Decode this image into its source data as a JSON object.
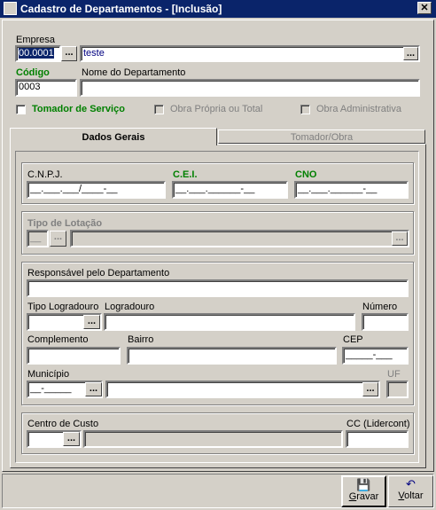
{
  "window": {
    "title": "Cadastro de Departamentos - [Inclusão]",
    "close": "✕"
  },
  "empresa": {
    "label": "Empresa",
    "code": "00.0001",
    "name": "teste",
    "lookup": "..."
  },
  "codigo": {
    "label": "Código",
    "value": "0003"
  },
  "nome_departamento": {
    "label": "Nome do Departamento",
    "value": ""
  },
  "checks": {
    "tomador": "Tomador de Serviço",
    "obra_propria": "Obra Própria ou Total",
    "obra_admin": "Obra Administrativa"
  },
  "tabs": [
    {
      "label": "Dados Gerais"
    },
    {
      "label": "Tomador/Obra"
    }
  ],
  "ids": {
    "cnpj": {
      "label": "C.N.P.J.",
      "mask": "__.___.___/____-__"
    },
    "cei": {
      "label": "C.E.I.",
      "mask": "__.___.______-__"
    },
    "cno": {
      "label": "CNO",
      "mask": "__.___.______-__"
    }
  },
  "lotacao": {
    "label": "Tipo de Lotação",
    "code": "__",
    "lookup": "...",
    "desc": "",
    "lookup2": "..."
  },
  "responsavel": {
    "label": "Responsável pelo Departamento",
    "value": ""
  },
  "tipo_logradouro": {
    "label": "Tipo Logradouro",
    "value": "",
    "lookup": "..."
  },
  "logradouro": {
    "label": "Logradouro",
    "value": ""
  },
  "numero": {
    "label": "Número",
    "value": ""
  },
  "complemento": {
    "label": "Complemento",
    "value": ""
  },
  "bairro": {
    "label": "Bairro",
    "value": ""
  },
  "cep": {
    "label": "CEP",
    "mask": "_____-___"
  },
  "municipio": {
    "label": "Município",
    "code": "__-_____",
    "lookup": "...",
    "name": "",
    "lookup2": "..."
  },
  "uf": {
    "label": "UF",
    "value": ""
  },
  "centro_custo": {
    "label": "Centro de Custo",
    "code": "",
    "lookup": "...",
    "desc": ""
  },
  "cc_lidercont": {
    "label": "CC (Lidercont)",
    "value": ""
  },
  "buttons": {
    "gravar": {
      "label_u": "G",
      "label_rest": "ravar",
      "icon": "💾"
    },
    "voltar": {
      "label_u": "V",
      "label_rest": "oltar",
      "icon": "↶"
    }
  }
}
